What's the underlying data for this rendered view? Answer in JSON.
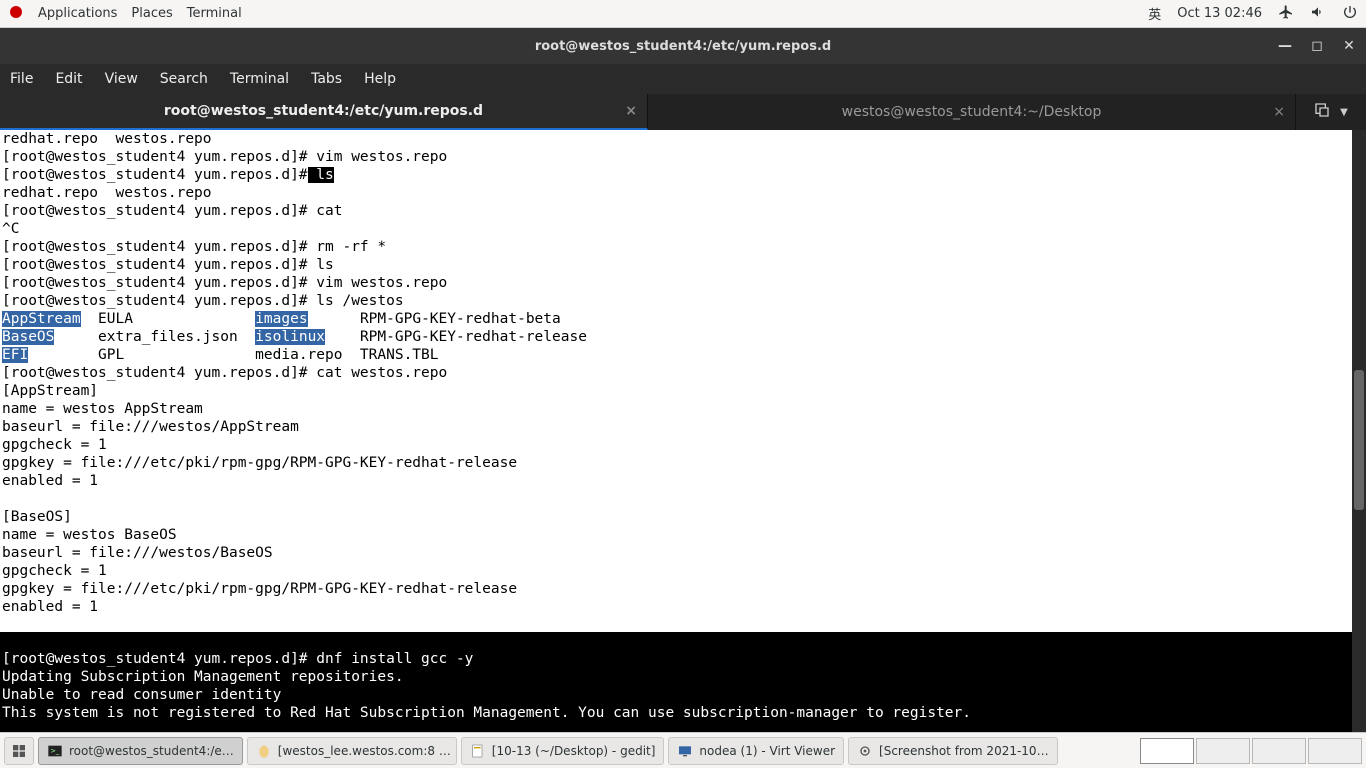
{
  "panel": {
    "apps": "Applications",
    "places": "Places",
    "terminal_menu": "Terminal",
    "ime": "英",
    "clock": "Oct 13  02:46"
  },
  "window": {
    "title": "root@westos_student4:/etc/yum.repos.d",
    "menus": [
      "File",
      "Edit",
      "View",
      "Search",
      "Terminal",
      "Tabs",
      "Help"
    ],
    "tabs": [
      {
        "label": "root@westos_student4:/etc/yum.repos.d",
        "active": true
      },
      {
        "label": "westos@westos_student4:~/Desktop",
        "active": false
      }
    ]
  },
  "term": {
    "line01": "redhat.repo  westos.repo",
    "line02": "[root@westos_student4 yum.repos.d]# vim westos.repo",
    "line03a": "[root@westos_student4 yum.repos.d]#",
    "line03b": " ls",
    "line04": "redhat.repo  westos.repo",
    "line05": "[root@westos_student4 yum.repos.d]# cat",
    "line06": "^C",
    "line07": "[root@westos_student4 yum.repos.d]# rm -rf *",
    "line08": "[root@westos_student4 yum.repos.d]# ls",
    "line09": "[root@westos_student4 yum.repos.d]# vim westos.repo",
    "line10": "[root@westos_student4 yum.repos.d]# ls /westos",
    "d_appstream": "AppStream",
    "d_eula": "  EULA              ",
    "d_images": "images",
    "d_rpmbeta": "      RPM-GPG-KEY-redhat-beta",
    "d_baseos": "BaseOS",
    "d_extra": "     extra_files.json  ",
    "d_isolinux": "isolinux",
    "d_rpmrel": "    RPM-GPG-KEY-redhat-release",
    "d_efi": "EFI",
    "d_gpl": "        GPL               media.repo  TRANS.TBL",
    "line14": "[root@westos_student4 yum.repos.d]# cat westos.repo",
    "line15": "[AppStream]",
    "line16": "name = westos AppStream",
    "line17": "baseurl = file:///westos/AppStream",
    "line18": "gpgcheck = 1",
    "line19": "gpgkey = file:///etc/pki/rpm-gpg/RPM-GPG-KEY-redhat-release",
    "line20": "enabled = 1",
    "line21": "",
    "line22": "[BaseOS]",
    "line23": "name = westos BaseOS",
    "line24": "baseurl = file:///westos/BaseOS",
    "line25": "gpgcheck = 1",
    "line26": "gpgkey = file:///etc/pki/rpm-gpg/RPM-GPG-KEY-redhat-release",
    "line27": "enabled = 1",
    "low1": "[root@westos_student4 yum.repos.d]# dnf install gcc -y",
    "low2": "Updating Subscription Management repositories.",
    "low3": "Unable to read consumer identity",
    "low4": "This system is not registered to Red Hat Subscription Management. You can use subscription-manager to register."
  },
  "taskbar": {
    "items": [
      {
        "label": "root@westos_student4:/e…",
        "active": true,
        "icon": "terminal"
      },
      {
        "label": "[westos_lee.westos.com:8 …",
        "active": false,
        "icon": "egg"
      },
      {
        "label": "[10-13 (~/Desktop) - gedit]",
        "active": false,
        "icon": "gedit"
      },
      {
        "label": "nodea (1) - Virt Viewer",
        "active": false,
        "icon": "screen"
      },
      {
        "label": "[Screenshot from 2021-10…",
        "active": false,
        "icon": "eye"
      }
    ]
  }
}
